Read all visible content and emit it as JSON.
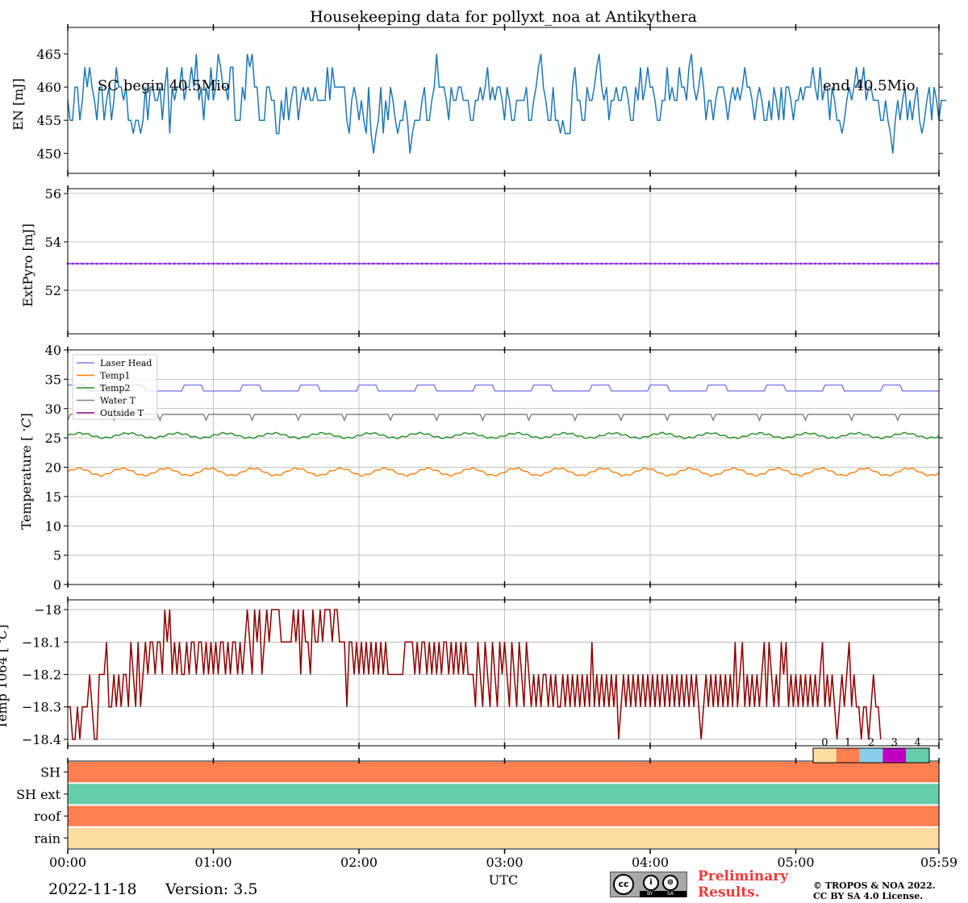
{
  "title": "Housekeeping data for pollyxt_noa at Antikythera",
  "date": "2022-11-18",
  "version": "Version: 3.5",
  "preliminary": [
    "Preliminary",
    "Results."
  ],
  "copyright": [
    "© TROPOS & NOA 2022.",
    "CC BY SA 4.0 License."
  ],
  "license_badge": {
    "symbols": [
      "cc",
      "i",
      "⊜"
    ],
    "labels": [
      "BY",
      "SA"
    ]
  },
  "annotations": {
    "sc_begin": "SC begin 40.5Mio",
    "sc_end": "end 40.5Mio"
  },
  "xaxis": {
    "label": "UTC",
    "ticks": [
      "00:00",
      "01:00",
      "02:00",
      "03:00",
      "04:00",
      "05:00",
      "05:59"
    ],
    "tick_minutes": [
      0,
      60,
      120,
      180,
      240,
      300,
      359
    ],
    "range_min": [
      0,
      359
    ]
  },
  "chart_data": [
    {
      "type": "line",
      "id": "energy",
      "ylabel": "EN [mJ]",
      "ylim": [
        447,
        469
      ],
      "yticks": [
        450,
        455,
        460,
        465
      ],
      "grid": false,
      "series": [
        {
          "color": "#1f77b4",
          "minutes_step": 1,
          "values": [
            458,
            455,
            455,
            460,
            460,
            455,
            458,
            463,
            460,
            463,
            460,
            458,
            455,
            460,
            460,
            455,
            458,
            460,
            455,
            458,
            463,
            460,
            460,
            458,
            460,
            455,
            455,
            453,
            455,
            455,
            453,
            455,
            460,
            455,
            460,
            460,
            458,
            458,
            460,
            455,
            460,
            463,
            453,
            460,
            458,
            460,
            460,
            463,
            458,
            460,
            460,
            463,
            460,
            465,
            458,
            460,
            455,
            460,
            458,
            463,
            458,
            460,
            465,
            463,
            460,
            460,
            458,
            463,
            463,
            455,
            455,
            455,
            460,
            458,
            465,
            463,
            465,
            460,
            460,
            455,
            455,
            455,
            460,
            460,
            458,
            458,
            453,
            453,
            458,
            455,
            460,
            455,
            458,
            460,
            460,
            455,
            458,
            460,
            458,
            460,
            458,
            458,
            460,
            458,
            458,
            458,
            458,
            463,
            458,
            463,
            460,
            460,
            460,
            460,
            460,
            455,
            453,
            458,
            460,
            458,
            455,
            458,
            455,
            453,
            460,
            453,
            450,
            453,
            455,
            460,
            453,
            458,
            455,
            460,
            458,
            455,
            453,
            455,
            455,
            458,
            455,
            450,
            453,
            455,
            455,
            455,
            458,
            460,
            455,
            455,
            458,
            460,
            465,
            460,
            460,
            460,
            458,
            455,
            460,
            458,
            458,
            460,
            460,
            458,
            458,
            458,
            455,
            455,
            458,
            458,
            460,
            458,
            460,
            463,
            458,
            460,
            458,
            460,
            460,
            458,
            455,
            460,
            458,
            455,
            455,
            458,
            458,
            458,
            458,
            460,
            455,
            455,
            458,
            460,
            463,
            465,
            460,
            458,
            455,
            455,
            460,
            455,
            455,
            453,
            455,
            453,
            453,
            453,
            460,
            463,
            458,
            458,
            455,
            455,
            460,
            458,
            458,
            460,
            463,
            465,
            460,
            458,
            460,
            455,
            458,
            458,
            460,
            458,
            458,
            460,
            460,
            458,
            455,
            455,
            460,
            458,
            463,
            458,
            460,
            463,
            460,
            460,
            458,
            455,
            455,
            458,
            458,
            463,
            458,
            460,
            458,
            458,
            463,
            460,
            460,
            458,
            463,
            465,
            460,
            458,
            460,
            463,
            460,
            455,
            458,
            458,
            455,
            458,
            460,
            460,
            460,
            458,
            455,
            458,
            460,
            458,
            460,
            458,
            460,
            463,
            460,
            460,
            458,
            455,
            458,
            460,
            458,
            455,
            455,
            458,
            455,
            460,
            458,
            455,
            460,
            455,
            460,
            460,
            458,
            455,
            458,
            458,
            460,
            458,
            460,
            460,
            460,
            463,
            460,
            458,
            463,
            458,
            460,
            460,
            455,
            460,
            458,
            455,
            455,
            453,
            455,
            458,
            460,
            458,
            460,
            463,
            460,
            460,
            463,
            458,
            460,
            460,
            458,
            458,
            458,
            455,
            455,
            458,
            455,
            453,
            450,
            455,
            458,
            455,
            458,
            460,
            455,
            458,
            455,
            458,
            460,
            455,
            453,
            455,
            458,
            460,
            455,
            460,
            458,
            455,
            458,
            458,
            458
          ]
        }
      ]
    },
    {
      "type": "scatter",
      "id": "extpyro",
      "ylabel": "ExtPyro [mJ]",
      "ylim": [
        50.2,
        56.2
      ],
      "yticks": [
        52,
        54,
        56
      ],
      "grid": true,
      "series": [
        {
          "color": "#8a2be2",
          "constant": 53.1,
          "minutes_step": 2
        }
      ]
    },
    {
      "type": "line",
      "id": "temperature",
      "ylabel": "Temperature [$^\\circ C$]",
      "ylim": [
        0,
        40
      ],
      "yticks": [
        0,
        5,
        10,
        15,
        20,
        25,
        30,
        35,
        40
      ],
      "grid": true,
      "legend": "upper-left",
      "series": [
        {
          "name": "Laser Head",
          "color": "#7b7bf0",
          "base": 33.2,
          "amp": 0.8,
          "period": 24
        },
        {
          "name": "Temp1",
          "color": "#ff7f0e",
          "base": 19.2,
          "amp": 0.6,
          "period": 18
        },
        {
          "name": "Temp2",
          "color": "#228b22",
          "base": 25.4,
          "amp": 0.4,
          "period": 20
        },
        {
          "name": "Water T",
          "color": "#808080",
          "base": 29.0,
          "amp": 0.6,
          "period": 30
        },
        {
          "name": "Outside T",
          "color": "#8b008b",
          "base": null,
          "amp": 0,
          "period": 0
        }
      ]
    },
    {
      "type": "line",
      "id": "temp1064",
      "ylabel": "Temp 1064 [$^\\circ C$]",
      "ylim": [
        -18.42,
        -17.97
      ],
      "yticks": [
        -18.4,
        -18.3,
        -18.2,
        -18.1,
        -18.0
      ],
      "grid": true,
      "series": [
        {
          "color": "#8b0000",
          "minutes_step": 1,
          "values": [
            -18.3,
            -18.3,
            -18.4,
            -18.4,
            -18.3,
            -18.4,
            -18.3,
            -18.3,
            -18.3,
            -18.2,
            -18.3,
            -18.4,
            -18.4,
            -18.2,
            -18.2,
            -18.2,
            -18.1,
            -18.3,
            -18.3,
            -18.2,
            -18.3,
            -18.2,
            -18.3,
            -18.2,
            -18.2,
            -18.3,
            -18.1,
            -18.2,
            -18.3,
            -18.1,
            -18.3,
            -18.2,
            -18.1,
            -18.2,
            -18.1,
            -18.1,
            -18.2,
            -18.1,
            -18.1,
            -18.2,
            -18.0,
            -18.1,
            -18.0,
            -18.2,
            -18.1,
            -18.2,
            -18.1,
            -18.2,
            -18.2,
            -18.1,
            -18.2,
            -18.1,
            -18.1,
            -18.2,
            -18.1,
            -18.1,
            -18.2,
            -18.1,
            -18.2,
            -18.1,
            -18.2,
            -18.1,
            -18.2,
            -18.1,
            -18.1,
            -18.2,
            -18.1,
            -18.2,
            -18.1,
            -18.1,
            -18.2,
            -18.1,
            -18.2,
            -18.1,
            -18.0,
            -18.1,
            -18.2,
            -18.0,
            -18.1,
            -18.0,
            -18.2,
            -18.1,
            -18.0,
            -18.1,
            -18.0,
            -18.0,
            -18.0,
            -18.0,
            -18.1,
            -18.1,
            -18.1,
            -18.1,
            -18.1,
            -18.0,
            -18.1,
            -18.0,
            -18.2,
            -18.0,
            -18.1,
            -18.1,
            -18.2,
            -18.0,
            -18.1,
            -18.1,
            -18.0,
            -18.1,
            -18.0,
            -18.0,
            -18.0,
            -18.1,
            -18.0,
            -18.0,
            -18.1,
            -18.1,
            -18.1,
            -18.3,
            -18.1,
            -18.1,
            -18.2,
            -18.1,
            -18.2,
            -18.1,
            -18.2,
            -18.1,
            -18.2,
            -18.1,
            -18.2,
            -18.1,
            -18.2,
            -18.1,
            -18.2,
            -18.1,
            -18.2,
            -18.2,
            -18.2,
            -18.2,
            -18.2,
            -18.2,
            -18.2,
            -18.1,
            -18.1,
            -18.1,
            -18.1,
            -18.2,
            -18.1,
            -18.2,
            -18.1,
            -18.1,
            -18.2,
            -18.1,
            -18.2,
            -18.1,
            -18.2,
            -18.1,
            -18.2,
            -18.1,
            -18.1,
            -18.2,
            -18.1,
            -18.2,
            -18.1,
            -18.2,
            -18.1,
            -18.2,
            -18.1,
            -18.2,
            -18.2,
            -18.2,
            -18.3,
            -18.1,
            -18.2,
            -18.3,
            -18.1,
            -18.2,
            -18.3,
            -18.1,
            -18.2,
            -18.3,
            -18.1,
            -18.2,
            -18.1,
            -18.2,
            -18.3,
            -18.1,
            -18.2,
            -18.3,
            -18.1,
            -18.2,
            -18.3,
            -18.1,
            -18.2,
            -18.3,
            -18.2,
            -18.3,
            -18.2,
            -18.3,
            -18.2,
            -18.2,
            -18.3,
            -18.2,
            -18.3,
            -18.2,
            -18.3,
            -18.3,
            -18.2,
            -18.3,
            -18.2,
            -18.3,
            -18.2,
            -18.3,
            -18.2,
            -18.3,
            -18.2,
            -18.3,
            -18.2,
            -18.3,
            -18.1,
            -18.3,
            -18.2,
            -18.3,
            -18.2,
            -18.3,
            -18.2,
            -18.3,
            -18.2,
            -18.3,
            -18.2,
            -18.4,
            -18.3,
            -18.2,
            -18.3,
            -18.2,
            -18.3,
            -18.2,
            -18.3,
            -18.2,
            -18.3,
            -18.2,
            -18.3,
            -18.2,
            -18.3,
            -18.2,
            -18.3,
            -18.2,
            -18.3,
            -18.2,
            -18.3,
            -18.2,
            -18.3,
            -18.2,
            -18.3,
            -18.2,
            -18.3,
            -18.2,
            -18.3,
            -18.2,
            -18.3,
            -18.2,
            -18.3,
            -18.2,
            -18.3,
            -18.4,
            -18.3,
            -18.2,
            -18.3,
            -18.2,
            -18.3,
            -18.2,
            -18.3,
            -18.2,
            -18.3,
            -18.2,
            -18.3,
            -18.2,
            -18.3,
            -18.1,
            -18.3,
            -18.2,
            -18.1,
            -18.3,
            -18.2,
            -18.3,
            -18.2,
            -18.3,
            -18.2,
            -18.3,
            -18.2,
            -18.1,
            -18.3,
            -18.1,
            -18.2,
            -18.3,
            -18.2,
            -18.3,
            -18.1,
            -18.2,
            -18.1,
            -18.3,
            -18.2,
            -18.3,
            -18.2,
            -18.3,
            -18.2,
            -18.3,
            -18.2,
            -18.3,
            -18.2,
            -18.3,
            -18.2,
            -18.3,
            -18.2,
            -18.1,
            -18.3,
            -18.2,
            -18.3,
            -18.2,
            -18.3,
            -18.4,
            -18.3,
            -18.2,
            -18.3,
            -18.2,
            -18.1,
            -18.3,
            -18.2,
            -18.3,
            -18.3,
            -18.4,
            -18.3,
            -18.3,
            -18.4,
            -18.3,
            -18.2,
            -18.3,
            -18.3,
            -18.4
          ]
        }
      ]
    },
    {
      "type": "heatmap",
      "id": "status",
      "rows": [
        "SH",
        "SH ext",
        "roof",
        "rain"
      ],
      "row_values": [
        1,
        4,
        1,
        0
      ],
      "colorbar": {
        "ticks": [
          "0",
          "1",
          "2",
          "3",
          "4"
        ],
        "colors": [
          "#fddda0",
          "#ff7f50",
          "#87ceeb",
          "#c000c0",
          "#66cdaa"
        ]
      }
    }
  ]
}
